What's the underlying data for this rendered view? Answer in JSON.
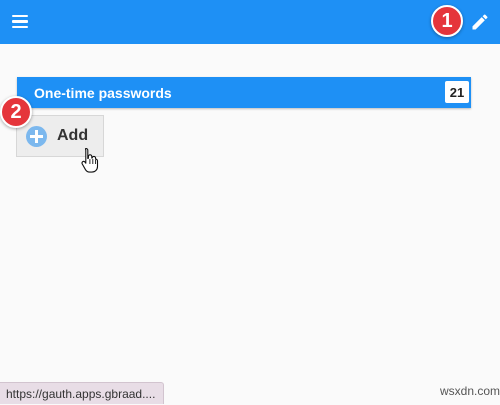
{
  "topbar": {
    "menu_icon": "hamburger-menu-icon",
    "edit_icon": "pencil-edit-icon",
    "accent_color": "#1e90f5"
  },
  "callouts": {
    "first": "1",
    "second": "2",
    "color": "#e5353b"
  },
  "section": {
    "title": "One-time passwords",
    "count": "21"
  },
  "add_button": {
    "label": "Add",
    "icon": "plus-circle-icon"
  },
  "status_bar": {
    "url": "https://gauth.apps.gbraad...."
  },
  "watermark": "wsxdn.com"
}
